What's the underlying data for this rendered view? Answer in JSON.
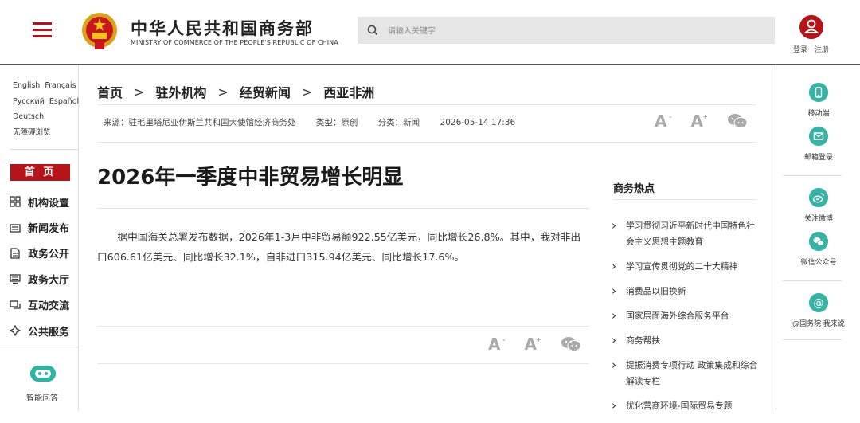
{
  "header": {
    "site_title_cn": "中华人民共和国商务部",
    "site_title_en": "MINISTRY OF COMMERCE OF THE PEOPLE'S REPUBLIC OF CHINA",
    "search_placeholder": "请输入关键字",
    "login": "登录",
    "register": "注册",
    "brand_color": "#b4141a"
  },
  "left_sidebar": {
    "languages": [
      "English",
      "Français",
      "Русский",
      "Español",
      "Deutsch",
      "无障碍浏览"
    ],
    "home": "首 页",
    "nav": [
      {
        "label": "机构设置",
        "icon": "grid-icon"
      },
      {
        "label": "新闻发布",
        "icon": "news-icon"
      },
      {
        "label": "政务公开",
        "icon": "document-icon"
      },
      {
        "label": "政务大厅",
        "icon": "monitor-icon"
      },
      {
        "label": "互动交流",
        "icon": "chat-icon"
      },
      {
        "label": "公共服务",
        "icon": "service-icon"
      }
    ],
    "assistant": "智能问答"
  },
  "breadcrumb": [
    "首页",
    "驻外机构",
    "经贸新闻",
    "西亚非洲"
  ],
  "meta": {
    "source": "来源：驻毛里塔尼亚伊斯兰共和国大使馆经济商务处",
    "type": "类型：原创",
    "category": "分类：新闻",
    "date": "2026-05-14 17:36"
  },
  "article": {
    "title": "2026年一季度中非贸易增长明显",
    "body": "据中国海关总署发布数据，2026年1-3月中非贸易额922.55亿美元，同比增长26.8%。其中，我对非出口606.61亿美元、同比增长32.1%，自非进口315.94亿美元、同比增长17.6%。"
  },
  "hot": {
    "title": "商务热点",
    "items": [
      "学习贯彻习近平新时代中国特色社会主义思想主题教育",
      "学习宣传贯彻党的二十大精神",
      "消费品以旧换新",
      "国家层面海外综合服务平台",
      "商务帮扶",
      "提振消费专项行动 政策集成和综合解读专栏",
      "优化营商环境-国际贸易专题"
    ]
  },
  "right_sidebar": {
    "items": [
      "移动端",
      "邮箱登录",
      "关注微博",
      "微信公众号",
      "@国务院 我来说"
    ]
  },
  "accent_color": "#38b2a4"
}
